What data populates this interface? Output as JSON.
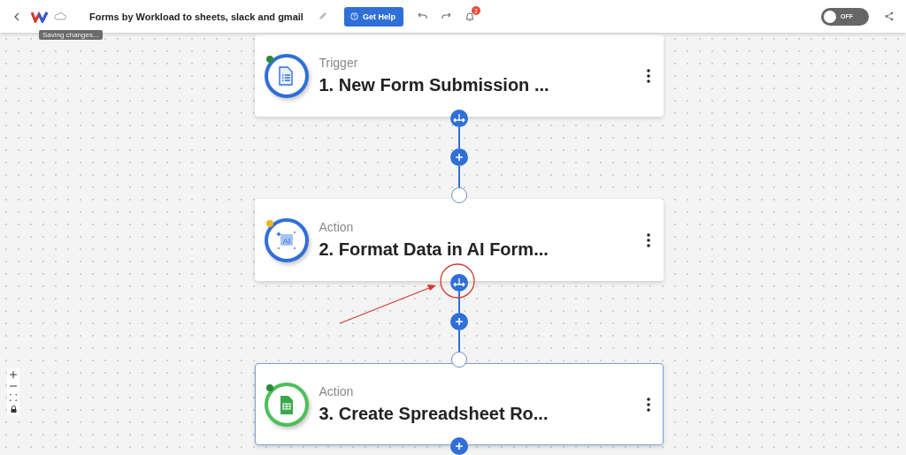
{
  "header": {
    "title": "Forms by Workload to sheets, slack and gmail",
    "help_button": "Get Help",
    "notification_count": "2",
    "tooltip": "Saving changes...",
    "toggle": {
      "label": "OFF",
      "on": false
    }
  },
  "steps": [
    {
      "kind": "form",
      "type_label": "Trigger",
      "title": "1. New Form Submission ...",
      "color": "#2e8b3a",
      "selected": false
    },
    {
      "kind": "ai",
      "icon_text": "AI",
      "type_label": "Action",
      "title": "2. Format Data in AI Form...",
      "color": "#f0b429",
      "selected": false
    },
    {
      "kind": "sheet",
      "type_label": "Action",
      "title": "3. Create Spreadsheet Ro...",
      "color": "#2e8b3a",
      "selected": true
    }
  ]
}
